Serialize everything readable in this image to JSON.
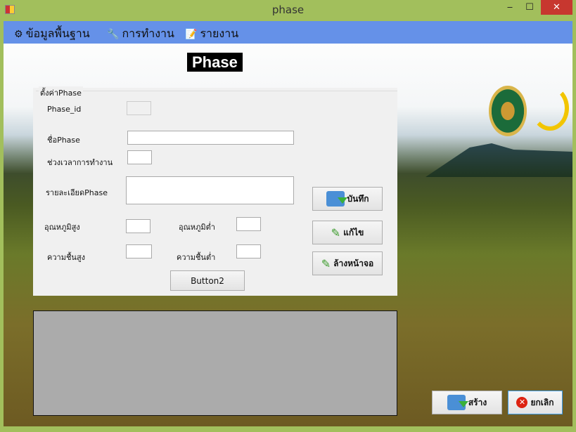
{
  "window": {
    "title": "phase",
    "minimize": "‒",
    "maximize": "☐",
    "close": "✕"
  },
  "menu": [
    {
      "label": "ข้อมูลพื้นฐาน",
      "icon": "gear-icon"
    },
    {
      "label": "การทำงาน",
      "icon": "tools-icon"
    },
    {
      "label": "รายงาน",
      "icon": "notepad-icon"
    }
  ],
  "heading": "Phase",
  "group": {
    "title": "ตั้งค่าPhase",
    "labels": {
      "phase_id": "Phase_id",
      "name": "ชื่อPhase",
      "duration": "ช่วงเวลาการทำงาน",
      "detail": "รายละเอียดPhase",
      "temp_high": "อุณหภูมิสูง",
      "temp_low": "อุณหภูมิต่ำ",
      "humid_high": "ความชื้นสูง",
      "humid_low": "ความชื้นต่ำ"
    },
    "button2": "Button2"
  },
  "buttons": {
    "save": "บันทึก",
    "edit": "แก้ไข",
    "clear": "ล้างหน้าจอ",
    "create": "สร้าง",
    "cancel": "ยกเลิก"
  }
}
